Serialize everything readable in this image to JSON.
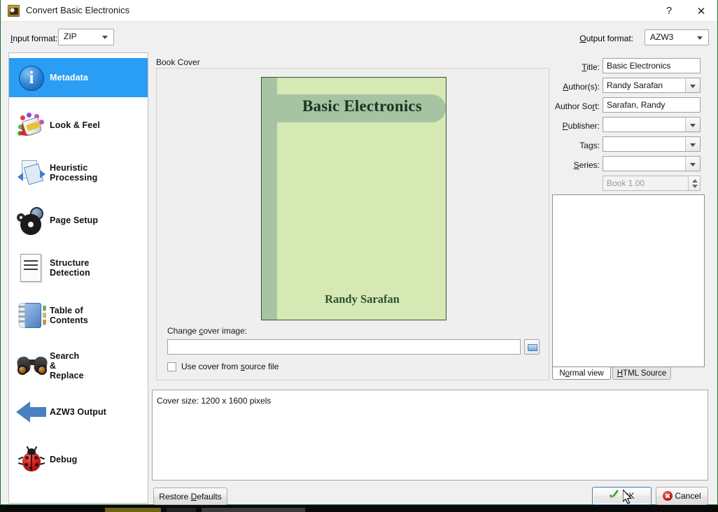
{
  "window": {
    "title": "Convert Basic Electronics",
    "icon": "calibre-app-icon",
    "help_label": "?",
    "close_label": "✕"
  },
  "formatbar": {
    "input_format_label": "Input format:",
    "input_format_value": "ZIP",
    "output_format_label": "Output format:",
    "output_format_value": "AZW3"
  },
  "sidebar": {
    "items": [
      {
        "label": "Metadata",
        "icon": "info-icon",
        "selected": true
      },
      {
        "label": "Look & Feel",
        "icon": "paint-bucket-icon",
        "selected": false
      },
      {
        "label": "Heuristic\nProcessing",
        "icon": "pages-rotate-icon",
        "selected": false
      },
      {
        "label": "Page Setup",
        "icon": "gears-icon",
        "selected": false
      },
      {
        "label": "Structure\nDetection",
        "icon": "document-lines-icon",
        "selected": false
      },
      {
        "label": "Table of\nContents",
        "icon": "notebook-icon",
        "selected": false
      },
      {
        "label": "Search\n&\nReplace",
        "icon": "binoculars-icon",
        "selected": false
      },
      {
        "label": "AZW3 Output",
        "icon": "left-arrow-icon",
        "selected": false
      },
      {
        "label": "Debug",
        "icon": "ladybug-icon",
        "selected": false
      }
    ]
  },
  "cover": {
    "group_label": "Book Cover",
    "book_title": "Basic Electronics",
    "book_author": "Randy Sarafan",
    "change_cover_label": "Change cover image:",
    "path_value": "",
    "browse_icon": "folder-icon",
    "use_source_cover_label": "Use cover from source file",
    "use_source_cover_checked": false,
    "colors": {
      "cover_background": "#d6e8b4",
      "cover_band": "#a7c4a2",
      "cover_border": "#3d4a3a",
      "title_text": "#1d3320",
      "author_text": "#2c5230"
    }
  },
  "metadata": {
    "fields": [
      {
        "label": "Title:",
        "value": "Basic Electronics",
        "dropdown": false,
        "disabled": false
      },
      {
        "label": "Author(s):",
        "value": "Randy Sarafan",
        "dropdown": true,
        "disabled": false
      },
      {
        "label": "Author Sort:",
        "value": "Sarafan, Randy",
        "dropdown": false,
        "disabled": false
      },
      {
        "label": "Publisher:",
        "value": "",
        "dropdown": true,
        "disabled": false
      },
      {
        "label": "Tags:",
        "value": "",
        "dropdown": true,
        "disabled": false
      },
      {
        "label": "Series:",
        "value": "",
        "dropdown": true,
        "disabled": false
      }
    ],
    "series_index": {
      "value": "Book 1.00",
      "disabled": true
    },
    "comments_value": "",
    "tabs": [
      {
        "label": "Normal view",
        "active": true
      },
      {
        "label": "HTML Source",
        "active": false
      }
    ]
  },
  "status": {
    "text": "Cover size: 1200 x 1600 pixels"
  },
  "buttons": {
    "restore_defaults": "Restore Defaults",
    "ok": "OK",
    "cancel": "Cancel"
  },
  "theme": {
    "accent_selection": "#2a9df4",
    "window_border": "#1f6e2d",
    "panel_background": "#f0f0f0"
  }
}
